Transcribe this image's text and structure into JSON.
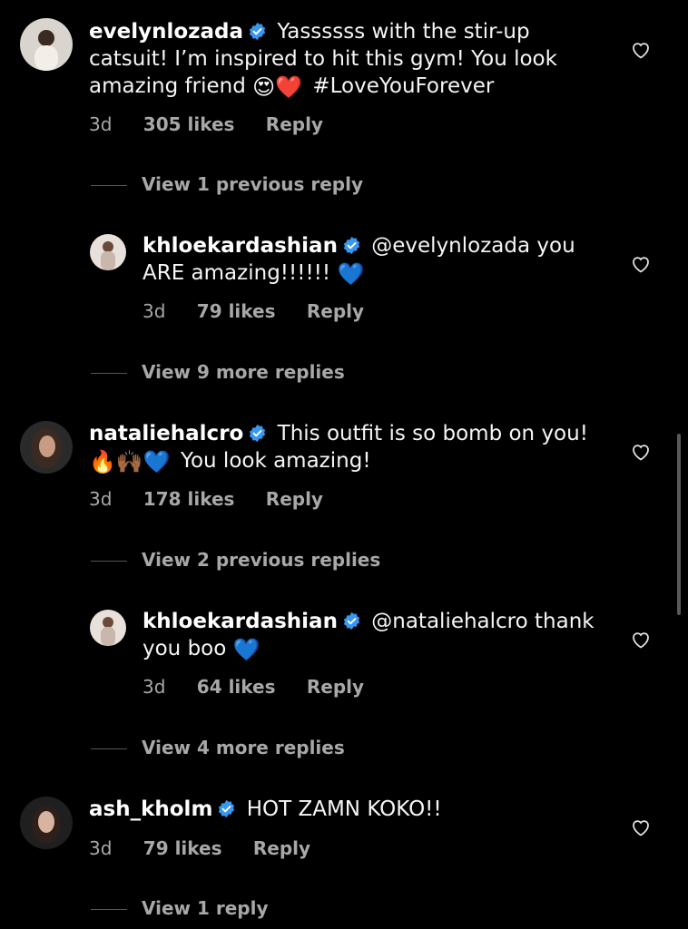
{
  "comments": [
    {
      "username": "evelynlozada",
      "text_before": "Yassssss with the stir-up catsuit! I’m inspired to hit this gym! You look amazing friend",
      "emojis": "😍❤️",
      "text_after": "#LoveYouForever",
      "time": "3d",
      "likes": "305 likes",
      "reply": "Reply",
      "view_replies": "View 1 previous reply"
    },
    {
      "username": "khloekardashian",
      "text_before": "@evelynlozada you ARE amazing!!!!!!",
      "emojis": "💙",
      "text_after": "",
      "time": "3d",
      "likes": "79 likes",
      "reply": "Reply",
      "view_replies": "View 9 more replies"
    },
    {
      "username": "nataliehalcro",
      "text_before": "This outfit is so bomb on you!",
      "emojis": "🔥🙌🏾💙",
      "text_after": "You look amazing!",
      "time": "3d",
      "likes": "178 likes",
      "reply": "Reply",
      "view_replies": "View 2 previous replies"
    },
    {
      "username": "khloekardashian",
      "text_before": "@nataliehalcro thank you boo",
      "emojis": "💙",
      "text_after": "",
      "time": "3d",
      "likes": "64 likes",
      "reply": "Reply",
      "view_replies": "View 4 more replies"
    },
    {
      "username": "ash_kholm",
      "text_before": "HOT ZAMN KOKO!!",
      "emojis": "",
      "text_after": "",
      "time": "3d",
      "likes": "79 likes",
      "reply": "Reply",
      "view_replies": "View 1 reply"
    }
  ],
  "icons": {
    "verified": "verified-badge-icon",
    "like": "heart-outline-icon"
  },
  "colors": {
    "background": "#000000",
    "text": "#f5f5f5",
    "secondary": "#a8a8a8",
    "verified_blue": "#3897f0"
  }
}
